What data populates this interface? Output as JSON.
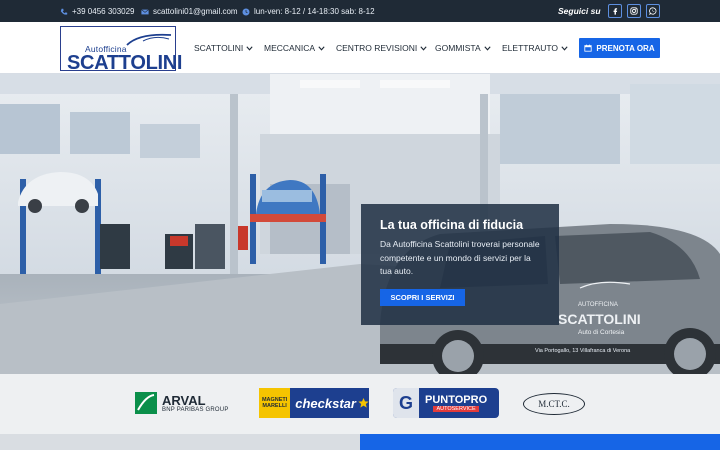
{
  "topbar": {
    "phone": "+39 0456 303029",
    "email": "scattolini01@gmail.com",
    "hours": "lun-ven: 8-12 / 14-18:30 sab: 8-12",
    "follow_label": "Seguici su",
    "social_icons": [
      "facebook-icon",
      "instagram-icon",
      "whatsapp-icon"
    ]
  },
  "logo": {
    "top_text": "Autofficina",
    "main_text": "Scattolini"
  },
  "nav": {
    "items": [
      {
        "label": "SCATTOLINI"
      },
      {
        "label": "MECCANICA"
      },
      {
        "label": "CENTRO REVISIONI"
      },
      {
        "label": "GOMMISTA"
      },
      {
        "label": "ELETTRAUTO"
      }
    ],
    "cta_label": "PRENOTA ORA"
  },
  "hero": {
    "title": "La tua officina di fiducia",
    "text": "Da Autofficina Scattolini troverai personale competente e un mondo di servizi per la tua auto.",
    "button_label": "SCOPRI I SERVIZI",
    "car_logo_top": "AUTOFFICINA",
    "car_logo_main": "SCATTOLINI",
    "car_logo_sub": "Auto di Cortesia",
    "car_address": "Via Portogallo, 13 Villafranca di Verona"
  },
  "partners": {
    "arval": {
      "name": "ARVAL",
      "sub": "BNP PARIBAS GROUP"
    },
    "checkstar": {
      "brand": "MAGNETI MARELLI",
      "name": "checkstar"
    },
    "puntopro": {
      "name": "PUNTOPRO",
      "sub": "AUTOSERVICE",
      "badge": "G"
    },
    "mctc": {
      "name": "M.CT.C."
    }
  },
  "colors": {
    "topbar": "#1f2a36",
    "accent": "#1665e6",
    "logo_blue": "#1d3f8f",
    "partners_bg": "#eef0f2"
  }
}
